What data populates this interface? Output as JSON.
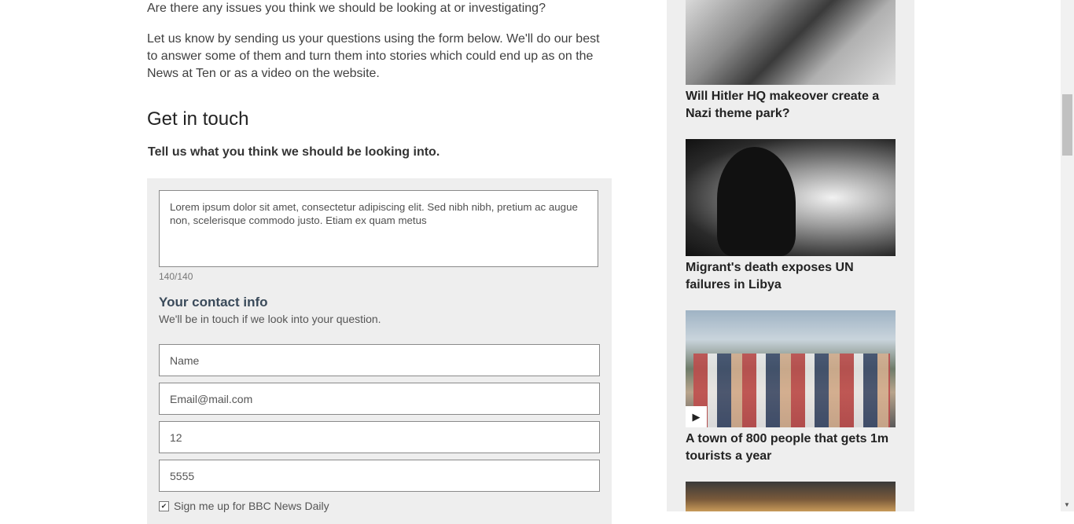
{
  "main": {
    "intro_question": "Are there any issues you think we should be looking at or investigating?",
    "intro_paragraph": "Let us know by sending us your questions using the form below. We'll do our best to answer some of them and turn them into stories which could end up as on the News at Ten or as a video on the website.",
    "heading": "Get in touch",
    "subheading": "Tell us what you think we should be looking into."
  },
  "form": {
    "question_value": "Lorem ipsum dolor sit amet, consectetur adipiscing elit. Sed nibh nibh, pretium ac augue non, scelerisque commodo justo. Etiam ex quam metus",
    "char_counter": "140/140",
    "contact_title": "Your contact info",
    "contact_subtitle": "We'll be in touch if we look into your question.",
    "name_value": "Name",
    "email_value": "Email@mail.com",
    "age_value": "12",
    "phone_value": "5555",
    "newsletter_label": "Sign me up for BBC News Daily",
    "newsletter_checked": true
  },
  "sidebar": {
    "stories": [
      {
        "title": "Will Hitler HQ makeover create a Nazi theme park?",
        "has_video": false
      },
      {
        "title": "Migrant's death exposes UN failures in Libya",
        "has_video": false
      },
      {
        "title": "A town of 800 people that gets 1m tourists a year",
        "has_video": true
      }
    ]
  },
  "icons": {
    "checkmark": "✔",
    "play": "▶",
    "scroll_down": "▼"
  }
}
